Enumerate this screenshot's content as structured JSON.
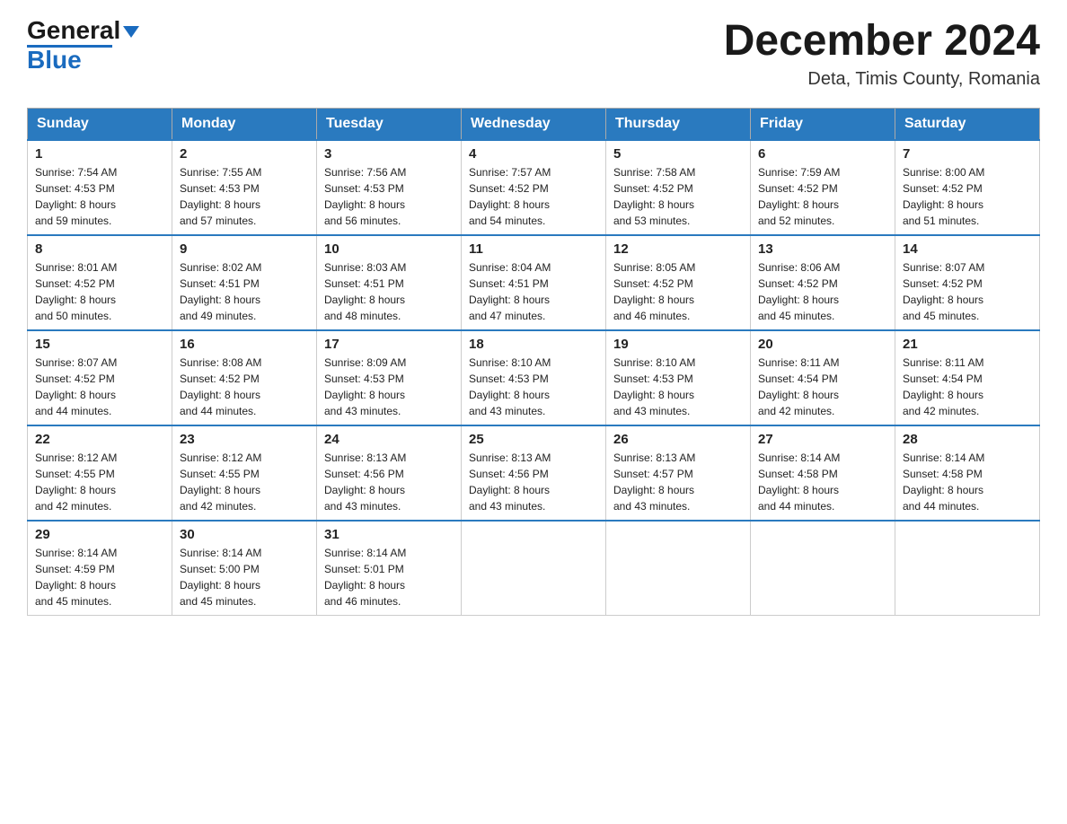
{
  "header": {
    "logo_general": "General",
    "logo_blue": "Blue",
    "title": "December 2024",
    "subtitle": "Deta, Timis County, Romania"
  },
  "days_of_week": [
    "Sunday",
    "Monday",
    "Tuesday",
    "Wednesday",
    "Thursday",
    "Friday",
    "Saturday"
  ],
  "weeks": [
    [
      {
        "day": "1",
        "info": "Sunrise: 7:54 AM\nSunset: 4:53 PM\nDaylight: 8 hours\nand 59 minutes."
      },
      {
        "day": "2",
        "info": "Sunrise: 7:55 AM\nSunset: 4:53 PM\nDaylight: 8 hours\nand 57 minutes."
      },
      {
        "day": "3",
        "info": "Sunrise: 7:56 AM\nSunset: 4:53 PM\nDaylight: 8 hours\nand 56 minutes."
      },
      {
        "day": "4",
        "info": "Sunrise: 7:57 AM\nSunset: 4:52 PM\nDaylight: 8 hours\nand 54 minutes."
      },
      {
        "day": "5",
        "info": "Sunrise: 7:58 AM\nSunset: 4:52 PM\nDaylight: 8 hours\nand 53 minutes."
      },
      {
        "day": "6",
        "info": "Sunrise: 7:59 AM\nSunset: 4:52 PM\nDaylight: 8 hours\nand 52 minutes."
      },
      {
        "day": "7",
        "info": "Sunrise: 8:00 AM\nSunset: 4:52 PM\nDaylight: 8 hours\nand 51 minutes."
      }
    ],
    [
      {
        "day": "8",
        "info": "Sunrise: 8:01 AM\nSunset: 4:52 PM\nDaylight: 8 hours\nand 50 minutes."
      },
      {
        "day": "9",
        "info": "Sunrise: 8:02 AM\nSunset: 4:51 PM\nDaylight: 8 hours\nand 49 minutes."
      },
      {
        "day": "10",
        "info": "Sunrise: 8:03 AM\nSunset: 4:51 PM\nDaylight: 8 hours\nand 48 minutes."
      },
      {
        "day": "11",
        "info": "Sunrise: 8:04 AM\nSunset: 4:51 PM\nDaylight: 8 hours\nand 47 minutes."
      },
      {
        "day": "12",
        "info": "Sunrise: 8:05 AM\nSunset: 4:52 PM\nDaylight: 8 hours\nand 46 minutes."
      },
      {
        "day": "13",
        "info": "Sunrise: 8:06 AM\nSunset: 4:52 PM\nDaylight: 8 hours\nand 45 minutes."
      },
      {
        "day": "14",
        "info": "Sunrise: 8:07 AM\nSunset: 4:52 PM\nDaylight: 8 hours\nand 45 minutes."
      }
    ],
    [
      {
        "day": "15",
        "info": "Sunrise: 8:07 AM\nSunset: 4:52 PM\nDaylight: 8 hours\nand 44 minutes."
      },
      {
        "day": "16",
        "info": "Sunrise: 8:08 AM\nSunset: 4:52 PM\nDaylight: 8 hours\nand 44 minutes."
      },
      {
        "day": "17",
        "info": "Sunrise: 8:09 AM\nSunset: 4:53 PM\nDaylight: 8 hours\nand 43 minutes."
      },
      {
        "day": "18",
        "info": "Sunrise: 8:10 AM\nSunset: 4:53 PM\nDaylight: 8 hours\nand 43 minutes."
      },
      {
        "day": "19",
        "info": "Sunrise: 8:10 AM\nSunset: 4:53 PM\nDaylight: 8 hours\nand 43 minutes."
      },
      {
        "day": "20",
        "info": "Sunrise: 8:11 AM\nSunset: 4:54 PM\nDaylight: 8 hours\nand 42 minutes."
      },
      {
        "day": "21",
        "info": "Sunrise: 8:11 AM\nSunset: 4:54 PM\nDaylight: 8 hours\nand 42 minutes."
      }
    ],
    [
      {
        "day": "22",
        "info": "Sunrise: 8:12 AM\nSunset: 4:55 PM\nDaylight: 8 hours\nand 42 minutes."
      },
      {
        "day": "23",
        "info": "Sunrise: 8:12 AM\nSunset: 4:55 PM\nDaylight: 8 hours\nand 42 minutes."
      },
      {
        "day": "24",
        "info": "Sunrise: 8:13 AM\nSunset: 4:56 PM\nDaylight: 8 hours\nand 43 minutes."
      },
      {
        "day": "25",
        "info": "Sunrise: 8:13 AM\nSunset: 4:56 PM\nDaylight: 8 hours\nand 43 minutes."
      },
      {
        "day": "26",
        "info": "Sunrise: 8:13 AM\nSunset: 4:57 PM\nDaylight: 8 hours\nand 43 minutes."
      },
      {
        "day": "27",
        "info": "Sunrise: 8:14 AM\nSunset: 4:58 PM\nDaylight: 8 hours\nand 44 minutes."
      },
      {
        "day": "28",
        "info": "Sunrise: 8:14 AM\nSunset: 4:58 PM\nDaylight: 8 hours\nand 44 minutes."
      }
    ],
    [
      {
        "day": "29",
        "info": "Sunrise: 8:14 AM\nSunset: 4:59 PM\nDaylight: 8 hours\nand 45 minutes."
      },
      {
        "day": "30",
        "info": "Sunrise: 8:14 AM\nSunset: 5:00 PM\nDaylight: 8 hours\nand 45 minutes."
      },
      {
        "day": "31",
        "info": "Sunrise: 8:14 AM\nSunset: 5:01 PM\nDaylight: 8 hours\nand 46 minutes."
      },
      null,
      null,
      null,
      null
    ]
  ]
}
